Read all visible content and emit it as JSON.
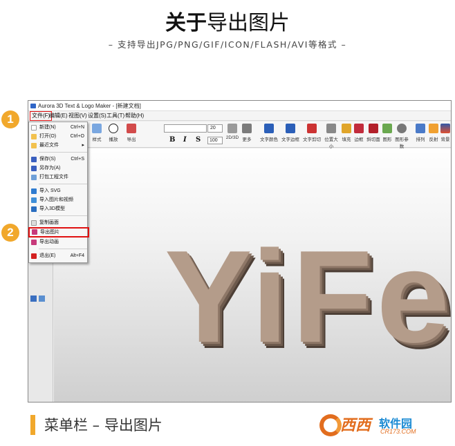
{
  "header": {
    "title_bold": "关于",
    "title_rest": "导出图片",
    "subtitle": "– 支持导出JPG/PNG/GIF/ICON/FLASH/AVI等格式 –"
  },
  "window": {
    "title": "Aurora 3D Text & Logo Maker - [新建文档]"
  },
  "menubar": [
    {
      "label": "文件(F)"
    },
    {
      "label": "编辑(E)"
    },
    {
      "label": "视图(V)"
    },
    {
      "label": "设置(S)"
    },
    {
      "label": "工具(T)"
    },
    {
      "label": "帮助(H)"
    }
  ],
  "toolbar": {
    "left_buttons": [
      "样式",
      "播放",
      "导出"
    ],
    "font_size": "20",
    "num_value": "100",
    "format_buttons": [
      "B",
      "I",
      "S"
    ],
    "mode_buttons": [
      "2D/3D",
      "更多"
    ],
    "text_tools": [
      "文字颜色",
      "文字边框",
      "文字剪切"
    ],
    "tools": [
      "位置大小",
      "填充",
      "边框",
      "斜切面",
      "图形",
      "图形参数",
      "排列",
      "反射",
      "背景"
    ]
  },
  "file_menu": {
    "items": [
      {
        "label": "新建(N)",
        "shortcut": "Ctrl+N",
        "color": "#ffffff"
      },
      {
        "label": "打开(O)",
        "shortcut": "Ctrl+O",
        "color": "#f2c14e"
      },
      {
        "label": "最近文件",
        "shortcut": "▸",
        "color": "#f2c14e"
      },
      {
        "label": "保存(S)",
        "shortcut": "Ctrl+S",
        "color": "#3a5fbf"
      },
      {
        "label": "另存为(A)",
        "shortcut": "",
        "color": "#3a5fbf"
      },
      {
        "label": "打包工程文件",
        "shortcut": "",
        "color": "#6fa0d8"
      },
      {
        "label": "导入 SVG",
        "shortcut": "",
        "color": "#2e7bd0"
      },
      {
        "label": "导入图片和视频",
        "shortcut": "",
        "color": "#3f8fd8"
      },
      {
        "label": "导入3D模型",
        "shortcut": "",
        "color": "#2a6ec0"
      },
      {
        "label": "复制画面",
        "shortcut": "",
        "color": "#dddddd"
      },
      {
        "label": "导出图片",
        "shortcut": "",
        "color": "#c73a7a"
      },
      {
        "label": "导出动画",
        "shortcut": "",
        "color": "#c73a7a"
      },
      {
        "label": "退出(E)",
        "shortcut": "Alt+F4",
        "color": "#d42020"
      }
    ]
  },
  "canvas": {
    "text": "YiFei"
  },
  "markers": [
    "1",
    "2"
  ],
  "caption": "菜单栏 – 导出图片",
  "watermark": {
    "logo": "西西",
    "brand": "软件园",
    "url": "CR173.COM"
  },
  "colors": {
    "accent": "#f1a82c",
    "highlight_border": "#e01010",
    "text_3d": "#b49c8a"
  }
}
